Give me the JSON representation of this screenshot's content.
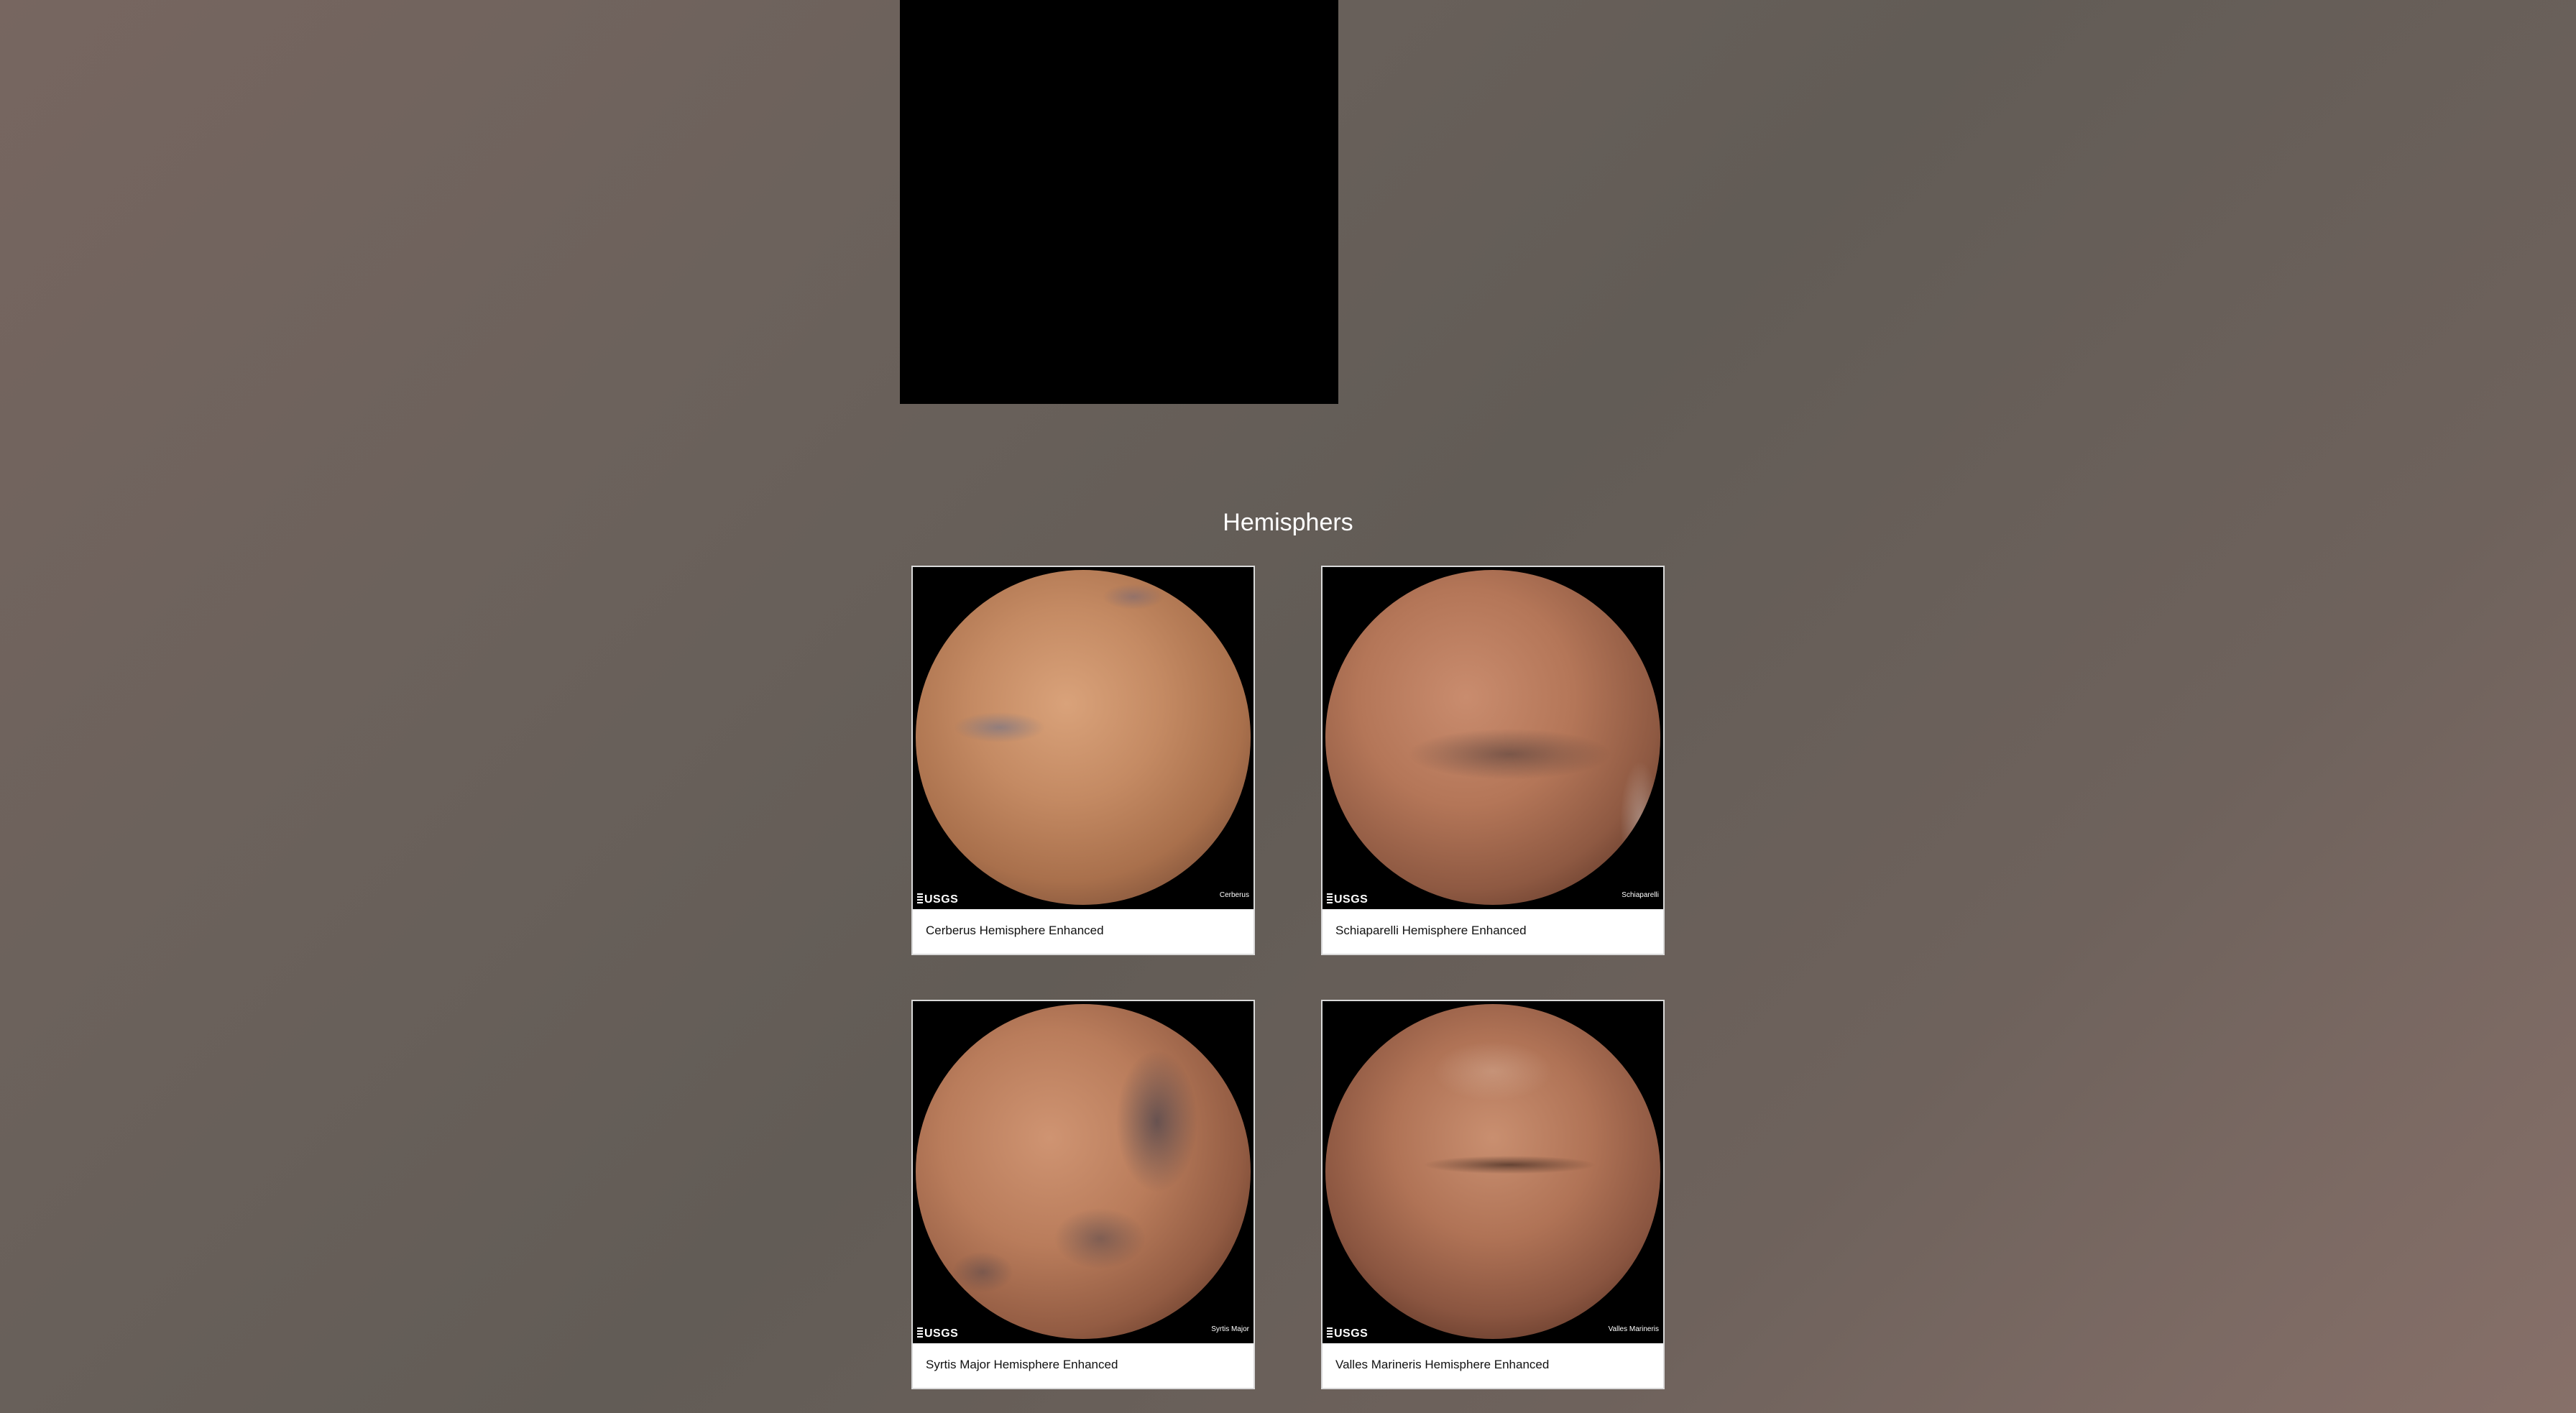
{
  "hemispheres": {
    "title": "Hemisphers",
    "items": [
      {
        "title": "Cerberus Hemisphere Enhanced",
        "image_label": "Cerberus",
        "logo": "USGS"
      },
      {
        "title": "Schiaparelli Hemisphere Enhanced",
        "image_label": "Schiaparelli",
        "logo": "USGS"
      },
      {
        "title": "Syrtis Major Hemisphere Enhanced",
        "image_label": "Syrtis Major",
        "logo": "USGS"
      },
      {
        "title": "Valles Marineris Hemisphere Enhanced",
        "image_label": "Valles Marineris",
        "logo": "USGS"
      }
    ]
  },
  "colors": {
    "page_background": "#6a615b",
    "card_background": "#ffffff",
    "title_text": "#ffffff"
  }
}
